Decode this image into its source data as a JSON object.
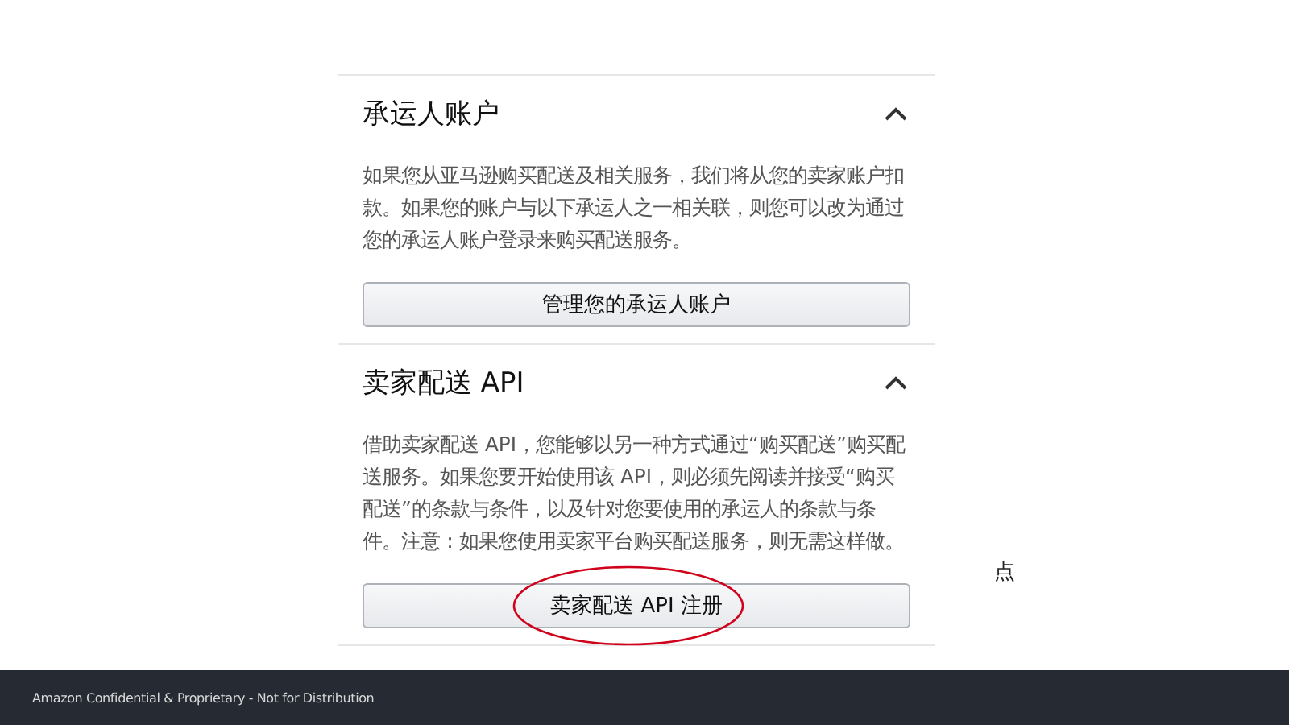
{
  "sections": [
    {
      "title": "承运人账户",
      "expanded": true,
      "body": "如果您从亚马逊购买配送及相关服务，我们将从您的卖家账户扣款。如果您的账户与以下承运人之一相关联，则您可以改为通过您的承运人账户登录来购买配送服务。",
      "button": "管理您的承运人账户",
      "circled": false
    },
    {
      "title": "卖家配送 API",
      "expanded": true,
      "body": "借助卖家配送 API，您能够以另一种方式通过“购买配送”购买配送服务。如果您要开始使用该 API，则必须先阅读并接受“购买配送”的条款与条件，以及针对您要使用的承运人的条款与条件。注意：如果您使用卖家平台购买配送服务，则无需这样做。",
      "button": "卖家配送 API 注册",
      "circled": true
    }
  ],
  "side_note": "点",
  "footer": "Amazon Confidential & Proprietary - Not for Distribution"
}
